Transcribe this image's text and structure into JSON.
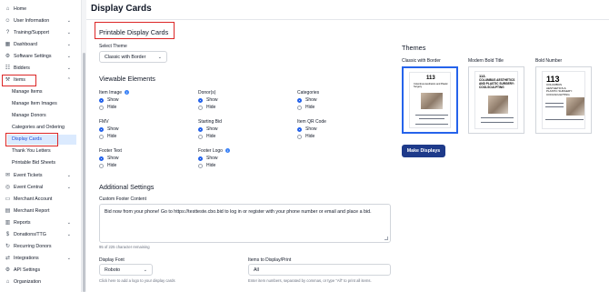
{
  "page": {
    "title": "Display Cards"
  },
  "sidebar": {
    "items": [
      {
        "label": "Home",
        "icon": "home-icon",
        "chevron": ""
      },
      {
        "label": "User Information",
        "icon": "user-icon",
        "chevron": "⌄"
      },
      {
        "label": "Training/Support",
        "icon": "help-icon",
        "chevron": "⌄"
      },
      {
        "label": "Dashboard",
        "icon": "dashboard-icon",
        "chevron": "⌄"
      },
      {
        "label": "Software Settings",
        "icon": "settings-icon",
        "chevron": "⌄"
      },
      {
        "label": "Bidders",
        "icon": "bidders-icon",
        "chevron": "⌄"
      },
      {
        "label": "Items",
        "icon": "gavel-icon",
        "chevron": "⌃"
      }
    ],
    "items_sub": [
      {
        "label": "Manage Items"
      },
      {
        "label": "Manage Item Images"
      },
      {
        "label": "Manage Donors"
      },
      {
        "label": "Categories and Ordering"
      },
      {
        "label": "Display Cards"
      },
      {
        "label": "Thank You Letters"
      },
      {
        "label": "Printable Bid Sheets"
      }
    ],
    "items_after": [
      {
        "label": "Event Tickets",
        "icon": "ticket-icon",
        "chevron": "⌄"
      },
      {
        "label": "Event Central",
        "icon": "event-icon",
        "chevron": "⌄"
      },
      {
        "label": "Merchant Account",
        "icon": "card-icon",
        "chevron": ""
      },
      {
        "label": "Merchant Report",
        "icon": "report-icon",
        "chevron": ""
      },
      {
        "label": "Reports",
        "icon": "chart-icon",
        "chevron": "⌄"
      },
      {
        "label": "Donations/TTG",
        "icon": "donation-icon",
        "chevron": "⌄"
      },
      {
        "label": "Recurring Donors",
        "icon": "recurring-icon",
        "chevron": ""
      },
      {
        "label": "Integrations",
        "icon": "integration-icon",
        "chevron": "⌄"
      },
      {
        "label": "API Settings",
        "icon": "api-icon",
        "chevron": ""
      },
      {
        "label": "Organization",
        "icon": "org-icon",
        "chevron": ""
      }
    ]
  },
  "printable": {
    "section_title": "Printable Display Cards",
    "select_theme_label": "Select Theme",
    "select_theme_value": "Classic with Border",
    "viewable_title": "Viewable Elements",
    "options": [
      {
        "label": "Item Image",
        "info": true,
        "show": "Show",
        "hide": "Hide",
        "selected": "show"
      },
      {
        "label": "Donor(s)",
        "info": false,
        "show": "Show",
        "hide": "Hide",
        "selected": "show"
      },
      {
        "label": "Categories",
        "info": false,
        "show": "Show",
        "hide": "Hide",
        "selected": "show"
      },
      {
        "label": "FMV",
        "info": false,
        "show": "Show",
        "hide": "Hide",
        "selected": "show"
      },
      {
        "label": "Starting Bid",
        "info": false,
        "show": "Show",
        "hide": "Hide",
        "selected": "show"
      },
      {
        "label": "Item QR Code",
        "info": false,
        "show": "Show",
        "hide": "Hide",
        "selected": "show"
      },
      {
        "label": "Footer Text",
        "info": false,
        "show": "Show",
        "hide": "Hide",
        "selected": "show"
      },
      {
        "label": "Footer Logo",
        "info": true,
        "show": "Show",
        "hide": "Hide",
        "selected": "show"
      }
    ],
    "additional_title": "Additional Settings",
    "footer_label": "Custom Footer Content",
    "footer_value": "Bid now from your phone! Go to https://testteste.cbo.bid to log in or register with your phone number or email and place a bid.",
    "char_remaining": "95 of 225 character remaining",
    "display_font_label": "Display Font",
    "display_font_value": "Roboto",
    "logo_hint": "Click here to add a logo to your display cards",
    "items_label": "Items to Display/Print",
    "items_value": "All",
    "items_hint": "Enter item numbers, separated by commas, or type \"All\" to print all items."
  },
  "themes": {
    "title": "Themes",
    "cards": [
      {
        "name": "Classic with Border",
        "number": "113",
        "heading": "Columbus Aesthetics and Plastic Surgery",
        "selected": true
      },
      {
        "name": "Modern Bold Title",
        "number": "113.",
        "heading": "COLUMBUS AESTHETICS AND PLASTIC SURGERY: COOLSCULPTING",
        "selected": false
      },
      {
        "name": "Bold Number",
        "number": "113",
        "heading": "COLUMBUS AESTHETICS & PLASTIC SURGERY: COOLSCULPTING",
        "selected": false
      }
    ],
    "button": "Make Displays"
  },
  "colors": {
    "accent": "#1e3a8a",
    "highlight": "#dc2626",
    "selection": "#dbeafe"
  }
}
